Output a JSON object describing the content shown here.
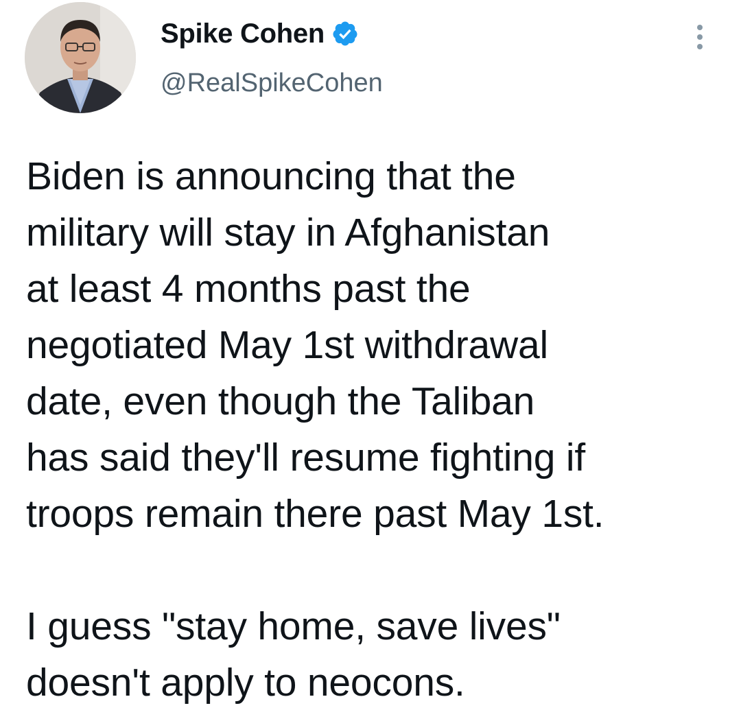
{
  "author": {
    "display_name": "Spike Cohen",
    "handle": "@RealSpikeCohen",
    "verified": true,
    "verified_color": "#1d9bf0"
  },
  "tweet": {
    "text": "Biden is announcing that the\nmilitary will stay in Afghanistan\nat least 4 months past the\nnegotiated May 1st withdrawal\ndate, even though the Taliban\nhas said they'll resume fighting if\ntroops remain there past May 1st.\n\nI guess \"stay home, save lives\"\ndoesn't apply to neocons."
  },
  "icons": {
    "verified": "verified-badge-icon",
    "more": "more-options-icon"
  },
  "colors": {
    "text": "#0f1419",
    "handle": "#536471"
  }
}
